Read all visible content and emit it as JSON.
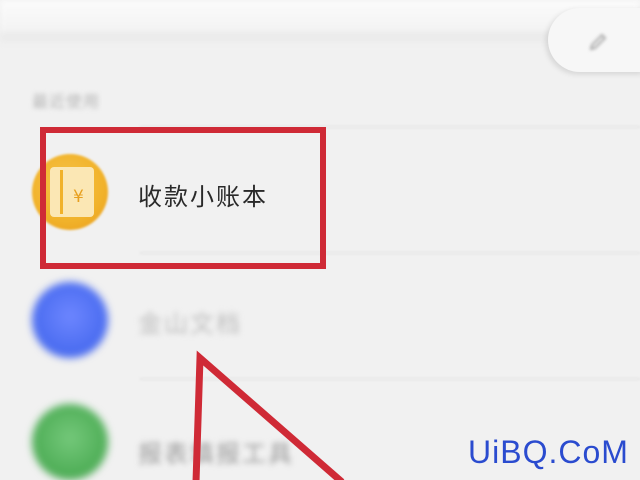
{
  "section": {
    "label": "最近使用"
  },
  "list": {
    "items": [
      {
        "label": "收款小账本",
        "icon": "ledger-yen-icon",
        "color": "#f1b22a",
        "highlighted": true
      },
      {
        "label": "金山文档",
        "icon": "kdocs-icon",
        "color": "#4a6cf0",
        "highlighted": false
      },
      {
        "label": "报表填报工具",
        "icon": "green-app-icon",
        "color": "#4fae57",
        "highlighted": false
      }
    ]
  },
  "header": {
    "edit_icon": "pencil-icon"
  },
  "annotation": {
    "color": "#cf2a36"
  },
  "watermark": {
    "text": "UiBQ.CoM",
    "color": "#2a4bcf"
  }
}
